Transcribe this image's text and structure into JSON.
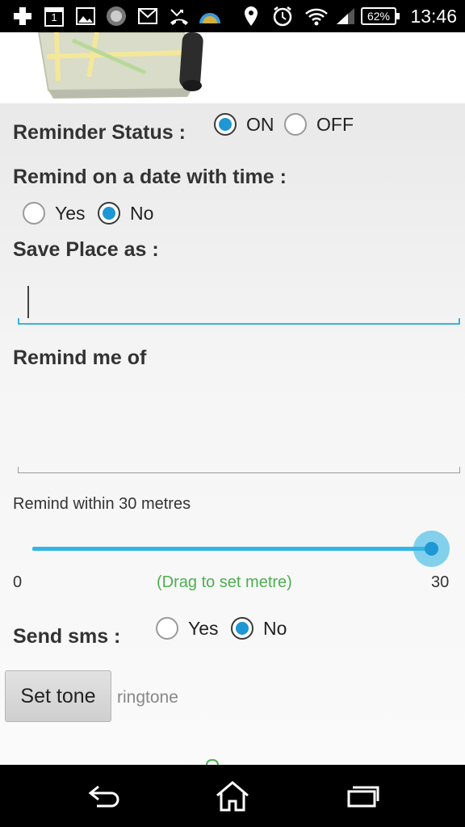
{
  "status_bar": {
    "icons": [
      "plus-icon",
      "calendar-icon",
      "image-icon",
      "app-icon",
      "gmail-icon",
      "missed-call-icon",
      "weather-icon",
      "location-icon",
      "alarm-icon",
      "wifi-icon",
      "signal-icon"
    ],
    "calendar_day": "1",
    "battery": "62%",
    "time": "13:46"
  },
  "form": {
    "reminder_status": {
      "label": "Reminder Status :",
      "options": [
        "ON",
        "OFF"
      ],
      "selected": "ON"
    },
    "remind_date": {
      "label": "Remind on a date with time :",
      "options": [
        "Yes",
        "No"
      ],
      "selected": "No"
    },
    "save_place": {
      "label": "Save Place as :",
      "value": ""
    },
    "remind_me_of": {
      "label": "Remind me of",
      "value": ""
    },
    "distance": {
      "label": "Remind within 30 metres",
      "min": "0",
      "max": "30",
      "value": 30,
      "hint": "(Drag to set metre)"
    },
    "send_sms": {
      "label": "Send sms :",
      "options": [
        "Yes",
        "No"
      ],
      "selected": "No"
    },
    "tone": {
      "button": "Set tone",
      "value": "ringtone"
    }
  },
  "colors": {
    "accent": "#33b5e5",
    "radio_selected": "#1e97d4",
    "hint": "#4caf50"
  }
}
